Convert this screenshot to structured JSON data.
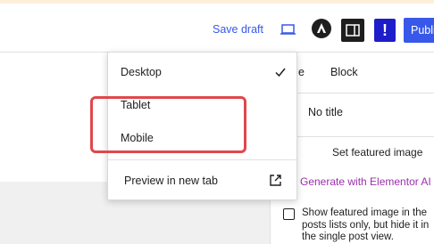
{
  "toolbar": {
    "save_draft": "Save draft",
    "sidebar_toggle_icon": "sidebar-panel-icon",
    "alert_label": "!",
    "publish_label": "Publish"
  },
  "settings_panel": {
    "tab_post_fragment": "e",
    "tab_block": "Block",
    "no_title": "No title",
    "set_featured_image": "Set featured image",
    "generate_elementor": "Generate with Elementor AI",
    "featured_checkbox_text": "Show featured image in the posts lists only, but hide it in the single post view."
  },
  "preview_menu": {
    "items": [
      {
        "label": "Desktop",
        "checked": true
      },
      {
        "label": "Tablet",
        "checked": false
      },
      {
        "label": "Mobile",
        "checked": false
      }
    ],
    "preview_new_tab": "Preview in new tab"
  },
  "colors": {
    "accent": "#3858e9",
    "highlight": "#e0474c",
    "elementor": "#9b2fae",
    "alert_button": "#1d1dc9"
  }
}
